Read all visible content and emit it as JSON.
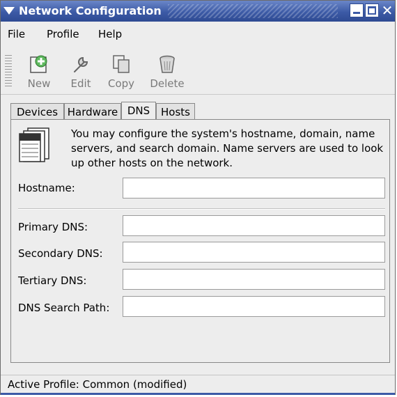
{
  "window": {
    "title": "Network Configuration"
  },
  "menubar": {
    "items": [
      "File",
      "Profile",
      "Help"
    ]
  },
  "toolbar": {
    "items": [
      {
        "label": "New",
        "icon": "new-icon"
      },
      {
        "label": "Edit",
        "icon": "edit-icon"
      },
      {
        "label": "Copy",
        "icon": "copy-icon"
      },
      {
        "label": "Delete",
        "icon": "delete-icon"
      }
    ]
  },
  "tabs": [
    "Devices",
    "Hardware",
    "DNS",
    "Hosts"
  ],
  "active_tab": "DNS",
  "dns": {
    "description": "You may configure the system's hostname, domain, name servers, and search domain. Name servers are used to look up other hosts on the network.",
    "fields": {
      "hostname": {
        "label": "Hostname:",
        "value": ""
      },
      "primary": {
        "label": "Primary DNS:",
        "value": ""
      },
      "secondary": {
        "label": "Secondary DNS:",
        "value": ""
      },
      "tertiary": {
        "label": "Tertiary DNS:",
        "value": ""
      },
      "search_path": {
        "label": "DNS Search Path:",
        "value": ""
      }
    }
  },
  "status": {
    "text": "Active Profile: Common (modified)"
  },
  "colors": {
    "titlebar": "#3c5aa6",
    "window_bg": "#ededed"
  }
}
